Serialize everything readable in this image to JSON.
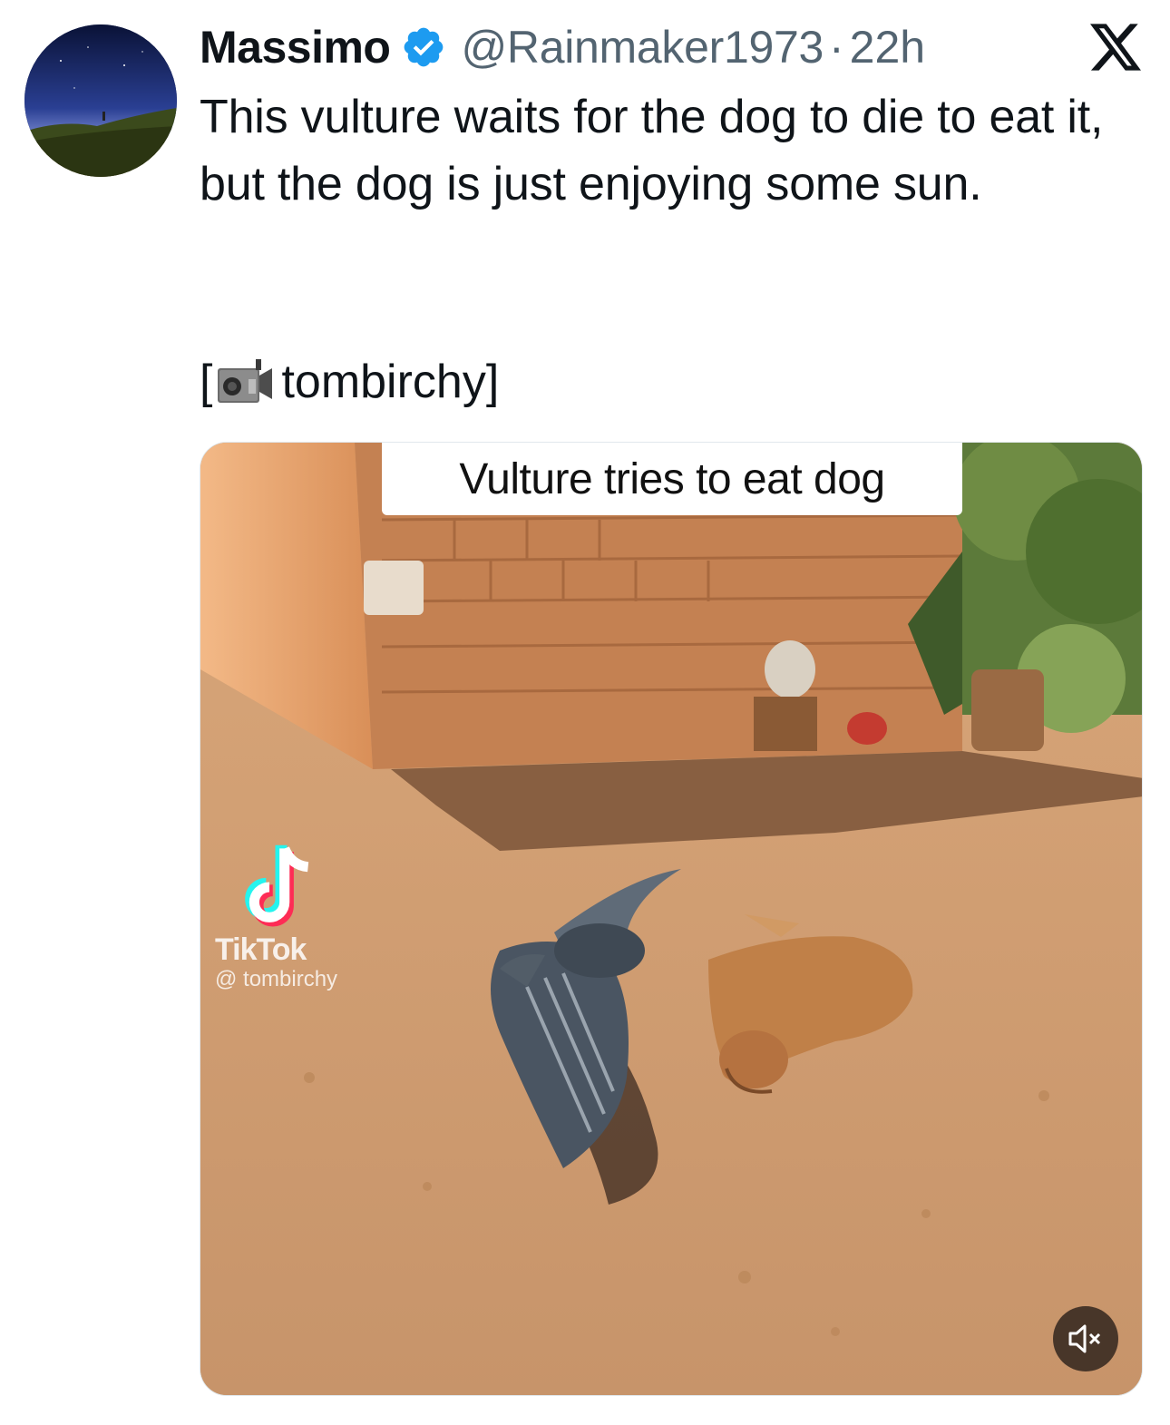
{
  "author": {
    "display_name": "Massimo",
    "handle": "@Rainmaker1973",
    "separator": "·",
    "time": "22h",
    "verified": true,
    "avatar_icon": "avatar-night-sky"
  },
  "platform_icon": "x-logo-icon",
  "tweet": {
    "text": "This vulture waits for the dog to die to eat it, but the dog is just enjoying some sun.",
    "credit_open": "[",
    "credit_icon": "video-camera-icon",
    "credit_name": "tombirchy]"
  },
  "media": {
    "caption": "Vulture tries to eat dog",
    "watermark": {
      "app": "TikTok",
      "user": "@ tombirchy"
    },
    "mute_icon": "speaker-muted-icon"
  },
  "colors": {
    "text_primary": "#0f1419",
    "text_secondary": "#536471",
    "verified_blue": "#1d9bf0"
  }
}
